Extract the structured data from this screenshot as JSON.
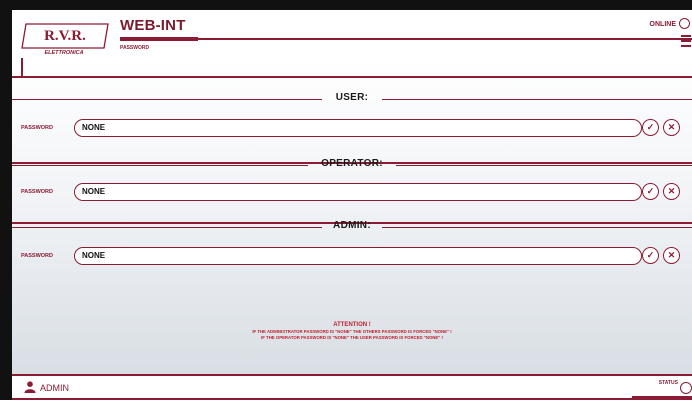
{
  "header": {
    "logo_text": "R.V.R.",
    "logo_sub": "ELETTRONICA",
    "app_title": "WEB-INT",
    "subtitle": "PASSWORD",
    "online_label": "ONLINE"
  },
  "sections": [
    {
      "title": "USER:",
      "password_label": "PASSWORD",
      "password_value": "NONE"
    },
    {
      "title": "OPERATOR:",
      "password_label": "PASSWORD",
      "password_value": "NONE"
    },
    {
      "title": "ADMIN:",
      "password_label": "PASSWORD",
      "password_value": "NONE"
    }
  ],
  "attention": {
    "title": "ATTENTION !",
    "line1": "IF THE ADMINISTRATOR PASSWORD IS \"NONE\" THE OTHERS PASSWORD IS FORCED \"NONE\" !",
    "line2": "IF THE OPERATOR PASSWORD IS \"NONE\" THE USER PASSWORD IS FORCED \"NONE\" !"
  },
  "footer": {
    "user_label": "ADMIN",
    "status_label": "STATUS"
  },
  "icons": {
    "confirm": "check-icon",
    "cancel": "close-icon",
    "online": "circle-icon",
    "menu": "hamburger-icon",
    "user": "user-icon"
  },
  "colors": {
    "accent": "#8b1c34",
    "warning": "#c0202f"
  }
}
